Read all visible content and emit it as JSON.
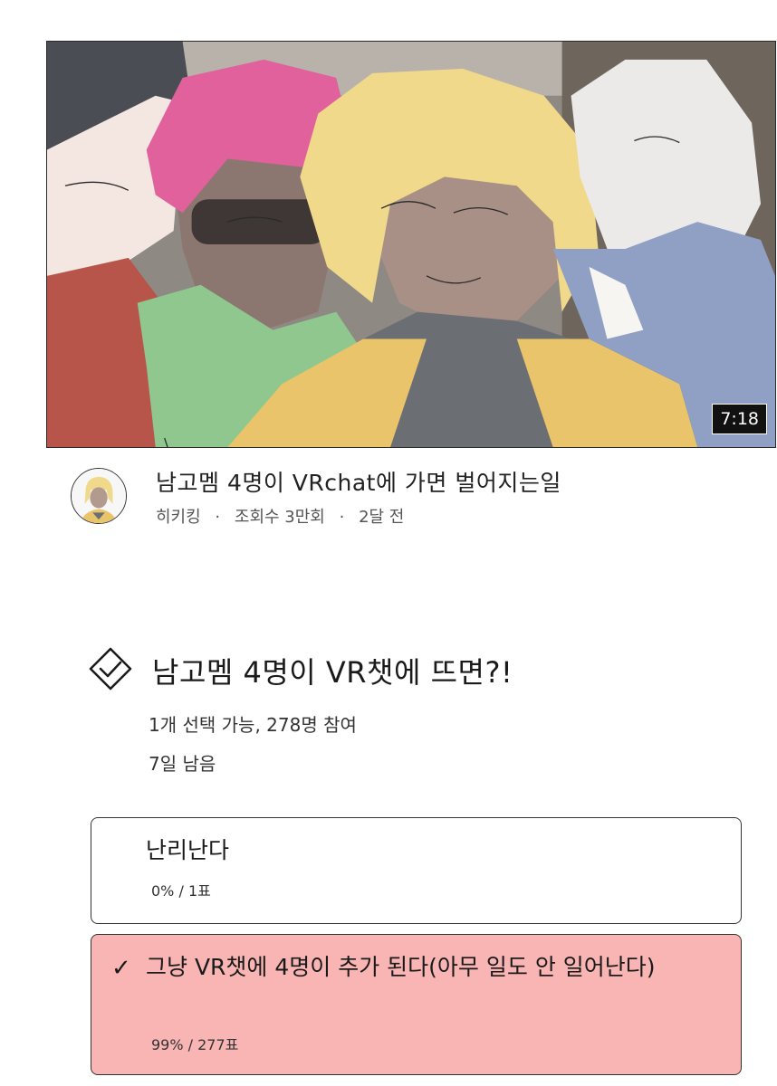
{
  "video": {
    "duration": "7:18",
    "title": "남고멤 4명이 VRchat에 가면 벌어지는일",
    "channel": "히키킹",
    "separator": "·",
    "views": "조회수 3만회",
    "uploaded": "2달 전"
  },
  "poll": {
    "icon": "check-badge-icon",
    "question": "남고멤 4명이 VR챗에 뜨면?!",
    "info": "1개 선택 가능, 278명 참여",
    "remaining": "7일 남음",
    "options": [
      {
        "label": "난리난다",
        "stat": "0% / 1표",
        "selected": false
      },
      {
        "label": "그냥 VR챗에 4명이 추가 된다(아무 일도 안 일어난다)",
        "stat": "99% / 277표",
        "selected": true
      }
    ],
    "check_mark": "✓"
  },
  "colors": {
    "selected_option_bg": "#f9b4b4",
    "hair_pink": "#e0619b",
    "hair_yellow": "#f1d98b",
    "jacket_blue": "#8fa0c4"
  }
}
